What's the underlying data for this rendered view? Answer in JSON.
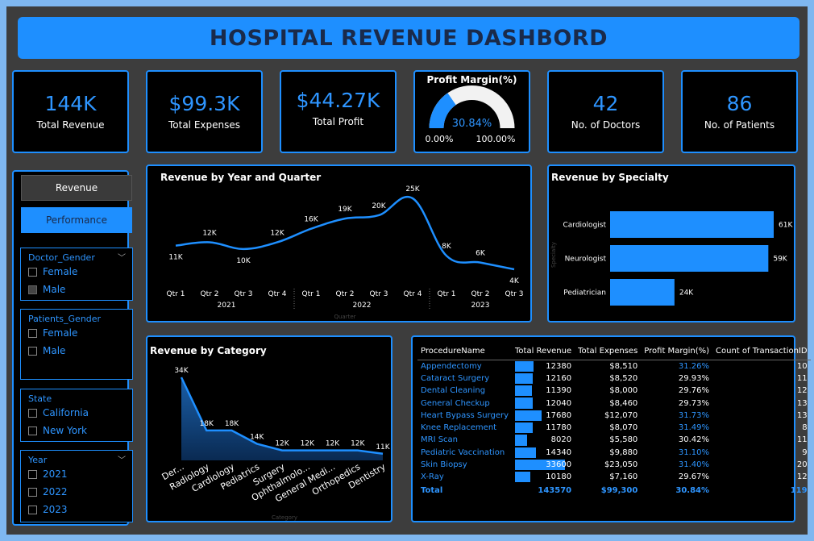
{
  "title": "HOSPITAL REVENUE DASHBORD",
  "kpis": {
    "revenue": {
      "value": "144K",
      "label": "Total Revenue"
    },
    "expenses": {
      "value": "$99.3K",
      "label": "Total Expenses"
    },
    "profit": {
      "value": "$44.27K",
      "label": "Total Profit"
    },
    "doctors": {
      "value": "42",
      "label": "No. of Doctors"
    },
    "patients": {
      "value": "86",
      "label": "No. of Patients"
    }
  },
  "gauge": {
    "title": "Profit Margin(%)",
    "value_label": "30.84%",
    "value": 30.84,
    "min_label": "0.00%",
    "max_label": "100.00%"
  },
  "nav": {
    "revenue_label": "Revenue",
    "performance_label": "Performance"
  },
  "filters": {
    "doctor_gender": {
      "title": "Doctor_Gender",
      "options": [
        "Female",
        "Male"
      ]
    },
    "patients_gender": {
      "title": "Patients_Gender",
      "options": [
        "Female",
        "Male"
      ]
    },
    "state": {
      "title": "State",
      "options": [
        "California",
        "New York"
      ]
    },
    "year": {
      "title": "Year",
      "options": [
        "2021",
        "2022",
        "2023"
      ]
    }
  },
  "chart_data": [
    {
      "type": "line",
      "title": "Revenue by Year and Quarter",
      "xlabel": "Quarter",
      "categories": [
        "Qtr 1",
        "Qtr 2",
        "Qtr 3",
        "Qtr 4",
        "Qtr 1",
        "Qtr 2",
        "Qtr 3",
        "Qtr 4",
        "Qtr 1",
        "Qtr 2",
        "Qtr 3"
      ],
      "groups": [
        {
          "label": "2021",
          "span": 4
        },
        {
          "label": "2022",
          "span": 4
        },
        {
          "label": "2023",
          "span": 3
        }
      ],
      "values": [
        11,
        12,
        10,
        12,
        16,
        19,
        20,
        25,
        8,
        6,
        4
      ],
      "labels": [
        "11K",
        "12K",
        "10K",
        "12K",
        "16K",
        "19K",
        "20K",
        "25K",
        "8K",
        "6K",
        "4K"
      ],
      "color": "#1e8fff"
    },
    {
      "type": "bar",
      "title": "Revenue by Specialty",
      "ylabel": "Specialty",
      "categories": [
        "Cardiologist",
        "Neurologist",
        "Pediatrician"
      ],
      "values": [
        61,
        59,
        24
      ],
      "labels": [
        "61K",
        "59K",
        "24K"
      ],
      "color": "#1e8fff"
    },
    {
      "type": "area",
      "title": "Revenue by Category",
      "xlabel": "Category",
      "categories": [
        "Der...",
        "Radiology",
        "Cardiology",
        "Pediatrics",
        "Surgery",
        "Ophthalmolo...",
        "General Medi...",
        "Orthopedics",
        "Dentistry"
      ],
      "values": [
        34,
        18,
        18,
        14,
        12,
        12,
        12,
        12,
        11
      ],
      "labels": [
        "34K",
        "18K",
        "18K",
        "14K",
        "12K",
        "12K",
        "12K",
        "12K",
        "11K"
      ],
      "color": "#1e8fff"
    }
  ],
  "table": {
    "headers": [
      "ProcedureName",
      "Total Revenue",
      "Total Expenses",
      "Profit Margin(%)",
      "Count of TransactionID"
    ],
    "rows": [
      {
        "name": "Appendectomy",
        "revenue": "12380",
        "rev": 12380,
        "expenses": "$8,510",
        "margin": "31.26%",
        "count": "10",
        "hi": true
      },
      {
        "name": "Cataract Surgery",
        "revenue": "12160",
        "rev": 12160,
        "expenses": "$8,520",
        "margin": "29.93%",
        "count": "11",
        "hi": false
      },
      {
        "name": "Dental Cleaning",
        "revenue": "11390",
        "rev": 11390,
        "expenses": "$8,000",
        "margin": "29.76%",
        "count": "12",
        "hi": false
      },
      {
        "name": "General Checkup",
        "revenue": "12040",
        "rev": 12040,
        "expenses": "$8,460",
        "margin": "29.73%",
        "count": "13",
        "hi": false
      },
      {
        "name": "Heart Bypass Surgery",
        "revenue": "17680",
        "rev": 17680,
        "expenses": "$12,070",
        "margin": "31.73%",
        "count": "13",
        "hi": true
      },
      {
        "name": "Knee Replacement",
        "revenue": "11780",
        "rev": 11780,
        "expenses": "$8,070",
        "margin": "31.49%",
        "count": "8",
        "hi": true
      },
      {
        "name": "MRI Scan",
        "revenue": "8020",
        "rev": 8020,
        "expenses": "$5,580",
        "margin": "30.42%",
        "count": "11",
        "hi": false
      },
      {
        "name": "Pediatric Vaccination",
        "revenue": "14340",
        "rev": 14340,
        "expenses": "$9,880",
        "margin": "31.10%",
        "count": "9",
        "hi": true
      },
      {
        "name": "Skin Biopsy",
        "revenue": "33600",
        "rev": 33600,
        "expenses": "$23,050",
        "margin": "31.40%",
        "count": "20",
        "hi": true
      },
      {
        "name": "X-Ray",
        "revenue": "10180",
        "rev": 10180,
        "expenses": "$7,160",
        "margin": "29.67%",
        "count": "12",
        "hi": false
      }
    ],
    "total": {
      "name": "Total",
      "revenue": "143570",
      "expenses": "$99,300",
      "margin": "30.84%",
      "count": "119"
    }
  }
}
